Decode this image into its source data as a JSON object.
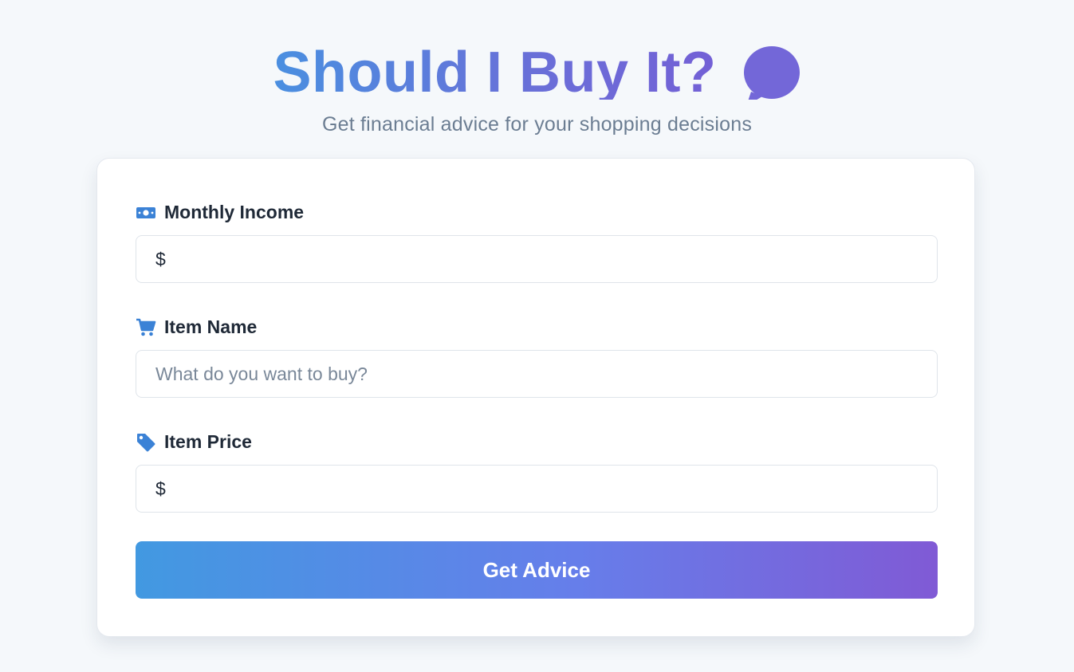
{
  "header": {
    "title": "Should I Buy It?",
    "title_icon": "speech-bubble-icon",
    "subtitle": "Get financial advice for your shopping decisions"
  },
  "form": {
    "income": {
      "icon": "money-bill-icon",
      "label": "Monthly Income",
      "prefix": "$",
      "value": ""
    },
    "item_name": {
      "icon": "shopping-cart-icon",
      "label": "Item Name",
      "placeholder": "What do you want to buy?",
      "value": ""
    },
    "item_price": {
      "icon": "price-tag-icon",
      "label": "Item Price",
      "prefix": "$",
      "value": ""
    },
    "submit_label": "Get Advice"
  },
  "colors": {
    "accent_start": "#4299e1",
    "accent_end": "#805ad5",
    "icon_blue": "#3b82d6",
    "background": "#f5f8fb"
  }
}
